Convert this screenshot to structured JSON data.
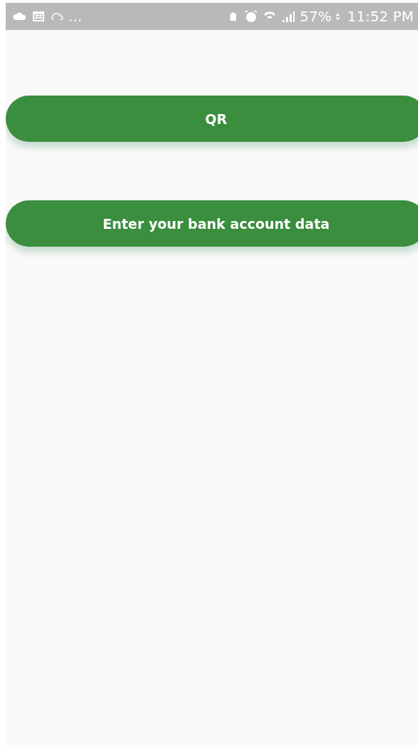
{
  "status_bar": {
    "overflow": "...",
    "battery": "57%",
    "time": "11:52 PM"
  },
  "buttons": [
    {
      "label": "QR"
    },
    {
      "label": "Enter your bank account data"
    }
  ]
}
